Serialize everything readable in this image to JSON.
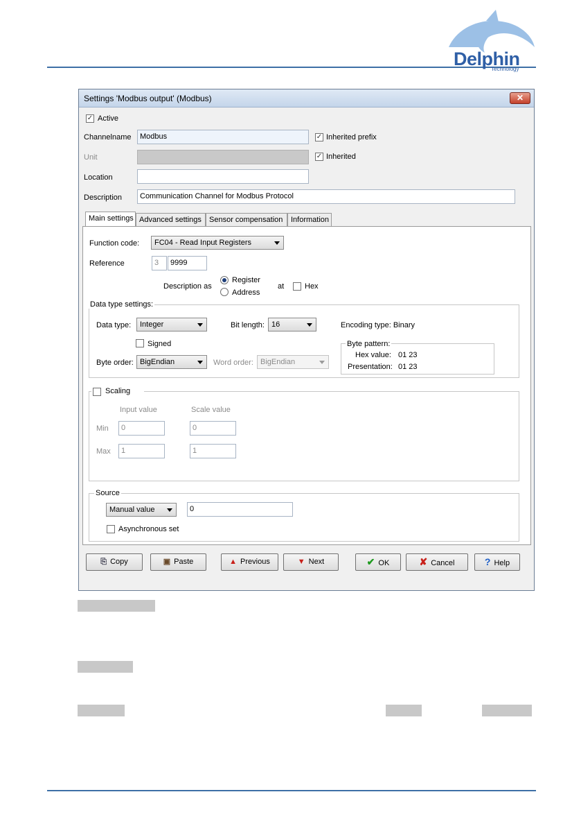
{
  "logo": {
    "name": "Delphin",
    "sub": "Technology"
  },
  "dialog": {
    "title": "Settings 'Modbus output' (Modbus)",
    "close": "✕",
    "active_label": "Active",
    "channelname_label": "Channelname",
    "channelname_value": "Modbus",
    "inherited_prefix_label": "Inherited prefix",
    "unit_label": "Unit",
    "inherited_label": "Inherited",
    "location_label": "Location",
    "description_label": "Description",
    "description_value": "Communication Channel for Modbus Protocol",
    "tabs": [
      "Main settings",
      "Advanced settings",
      "Sensor compensation",
      "Information"
    ],
    "function_code_label": "Function code:",
    "function_code_value": "FC04 - Read Input Registers",
    "reference_label": "Reference",
    "reference_prefix": "3",
    "reference_value": "9999",
    "description_as_label": "Description as",
    "register_label": "Register",
    "address_label": "Address",
    "at_label": "at",
    "hex_label": "Hex",
    "data_type_group": "Data type settings:",
    "data_type_label": "Data type:",
    "data_type_value": "Integer",
    "bit_length_label": "Bit length:",
    "bit_length_value": "16",
    "encoding_type": "Encoding type: Binary",
    "signed_label": "Signed",
    "byte_order_label": "Byte order:",
    "byte_order_value": "BigEndian",
    "word_order_label": "Word order:",
    "word_order_value": "BigEndian",
    "byte_pattern_label": "Byte pattern:",
    "hex_value_label": "Hex value:",
    "hex_value": "01 23",
    "presentation_label": "Presentation:",
    "presentation_value": "01 23",
    "scaling_label": "Scaling",
    "input_value_label": "Input value",
    "scale_value_label": "Scale value",
    "min_label": "Min",
    "max_label": "Max",
    "min_input": "0",
    "min_scale": "0",
    "max_input": "1",
    "max_scale": "1",
    "source_label": "Source",
    "source_value": "Manual value",
    "source_input": "0",
    "async_label": "Asynchronous set",
    "buttons": {
      "copy": "Copy",
      "paste": "Paste",
      "previous": "Previous",
      "next": "Next",
      "ok": "OK",
      "cancel": "Cancel",
      "help": "Help"
    }
  }
}
